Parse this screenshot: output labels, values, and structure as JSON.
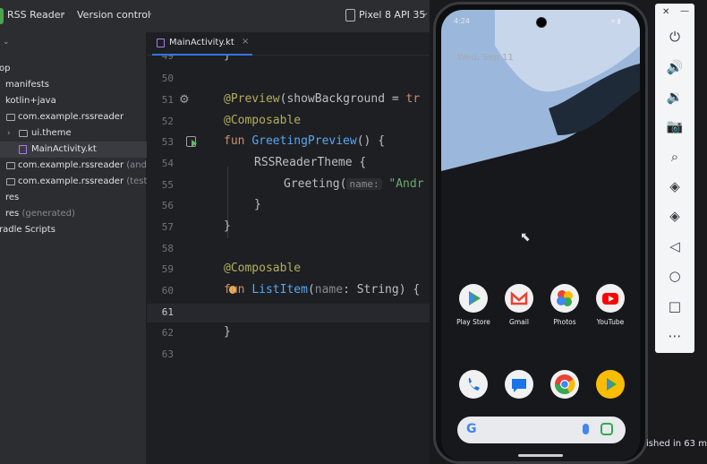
{
  "toolbar": {
    "project_name": "RSS Reader",
    "vcs_label": "Version control",
    "device_label": "Pixel 8 API 35"
  },
  "project_tree": {
    "items": [
      {
        "label": "op",
        "suffix": ""
      },
      {
        "label": "manifests",
        "suffix": ""
      },
      {
        "label": "kotlin+java",
        "suffix": ""
      },
      {
        "label": "com.example.rssreader",
        "suffix": ""
      },
      {
        "label": "ui.theme",
        "suffix": ""
      },
      {
        "label": "MainActivity.kt",
        "suffix": ""
      },
      {
        "label": "com.example.rssreader",
        "suffix": " (andro"
      },
      {
        "label": "com.example.rssreader",
        "suffix": " (test)"
      },
      {
        "label": "res",
        "suffix": ""
      },
      {
        "label": "res",
        "suffix": " (generated)"
      },
      {
        "label": "radle Scripts",
        "suffix": ""
      }
    ]
  },
  "editor": {
    "tab_label": "MainActivity.kt",
    "line_numbers": [
      "49",
      "50",
      "51",
      "52",
      "53",
      "54",
      "55",
      "56",
      "57",
      "58",
      "59",
      "60",
      "61",
      "62",
      "63"
    ],
    "code": {
      "l49": "}",
      "l51_ann": "@Preview",
      "l51_rest": "(showBackground = ",
      "l51_kw": "tr",
      "l52_ann": "@Composable",
      "l53_kw": "fun ",
      "l53_fn": "GreetingPreview",
      "l53_rest": "() {",
      "l54": "RSSReaderTheme {",
      "l55_call": "Greeting(",
      "l55_hint": "name:",
      "l55_str": " \"Andr",
      "l56": "}",
      "l57": "}",
      "l59_ann": "@Composable",
      "l60_kw": "fun ",
      "l60_fn": "ListItem",
      "l60_rest1": "(",
      "l60_param": "name",
      "l60_rest2": ": String) {",
      "l62": "}"
    }
  },
  "phone": {
    "status_time": "4:24",
    "date_label": "Wed, Sep 11",
    "apps_row1": [
      {
        "label": "Play Store",
        "icon": "play-store-icon",
        "color": "#34a853"
      },
      {
        "label": "Gmail",
        "icon": "gmail-icon",
        "color": "#ea4335"
      },
      {
        "label": "Photos",
        "icon": "photos-icon",
        "color": "#fbbc04"
      },
      {
        "label": "YouTube",
        "icon": "youtube-icon",
        "color": "#ff0000"
      }
    ],
    "apps_row2": [
      {
        "icon": "phone-icon",
        "color": "#1a73e8"
      },
      {
        "icon": "messages-icon",
        "color": "#1a73e8"
      },
      {
        "icon": "chrome-icon",
        "color": "#4285f4"
      },
      {
        "icon": "play-games-icon",
        "color": "#34a853"
      }
    ],
    "search_logo": "G"
  },
  "side_panel": {
    "buttons": [
      "power-icon",
      "volume-up-icon",
      "volume-down-icon",
      "camera-icon",
      "zoom-icon",
      "rotate-left-icon",
      "rotate-right-icon",
      "back-icon",
      "home-icon",
      "overview-icon",
      "more-icon"
    ]
  },
  "status": {
    "bottom_text": "ished in 63 m"
  }
}
